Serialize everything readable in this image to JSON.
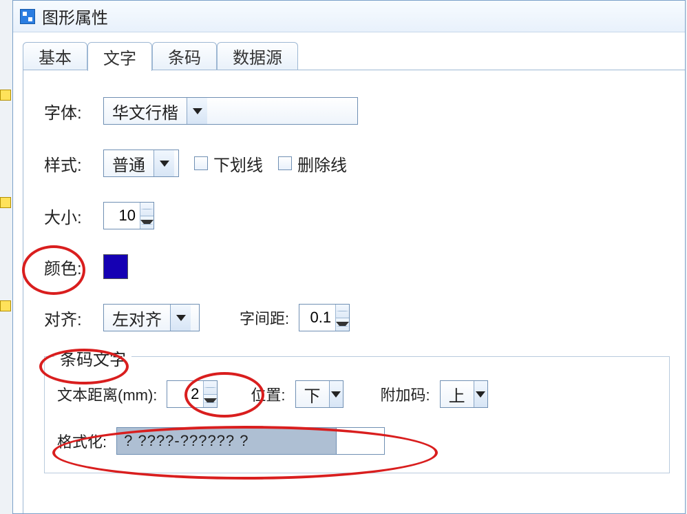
{
  "window": {
    "title": "图形属性"
  },
  "tabs": {
    "basic": "基本",
    "text": "文字",
    "barcode": "条码",
    "datasource": "数据源"
  },
  "labels": {
    "font": "字体:",
    "style": "样式:",
    "underline": "下划线",
    "strikethrough": "删除线",
    "size": "大小:",
    "color": "颜色:",
    "align": "对齐:",
    "charSpacing": "字间距:",
    "groupTitle": "条码文字",
    "textDistance": "文本距离(mm):",
    "position": "位置:",
    "addonCode": "附加码:",
    "format": "格式化:"
  },
  "values": {
    "font": "华文行楷",
    "style": "普通",
    "size": "10",
    "colorHex": "#1500b3",
    "align": "左对齐",
    "charSpacing": "0.1",
    "textDistance": "2",
    "position": "下",
    "addonCode": "上",
    "formatMask": "?   ????-??????     ?",
    "underlineChecked": false,
    "strikethroughChecked": false
  }
}
